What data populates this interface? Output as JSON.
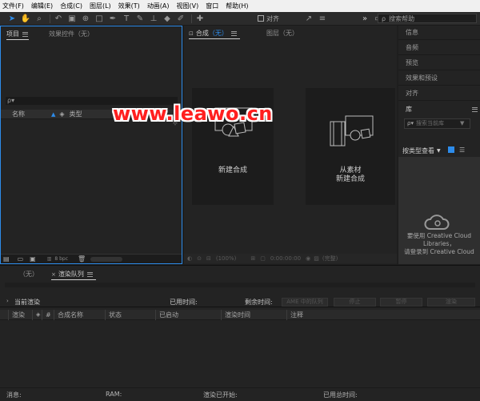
{
  "menu": [
    "文件(F)",
    "编辑(E)",
    "合成(C)",
    "图层(L)",
    "效果(T)",
    "动画(A)",
    "视图(V)",
    "窗口",
    "帮助(H)"
  ],
  "toolbar": {
    "snap_label": "对齐",
    "search_placeholder": "搜索帮助"
  },
  "project": {
    "tab_project": "项目",
    "tab_effects": "效果控件（无）",
    "search_icon_text": "ρ▾",
    "col_name": "名称",
    "col_type": "类型",
    "bpc": "8 bpc"
  },
  "comp": {
    "tab_comp_prefix": "合成",
    "tab_comp_value": "（无）",
    "tab_layer": "图层（无）",
    "new_comp": "新建合成",
    "from_footage_line1": "从素材",
    "from_footage_line2": "新建合成",
    "footer_zoom": "(100%)",
    "footer_time": "0:00:00:00",
    "footer_res": "(完整)"
  },
  "right_panel": {
    "items": [
      "信息",
      "音频",
      "预览",
      "效果和预设",
      "对齐"
    ],
    "library_title": "库",
    "library_search_placeholder": "搜索当前库",
    "view_by_type": "按类型查看",
    "cc_line1": "要使用 Creative Cloud",
    "cc_line2": "Libraries，",
    "cc_line3": "请登录到 Creative Cloud"
  },
  "bottom": {
    "tab_none": "（无）",
    "tab_render": "渲染队列",
    "current_render": "当前渲染",
    "elapsed": "已用时间:",
    "remaining": "剩余时间:",
    "ame_queue": "AME 中的队列",
    "stop": "停止",
    "pause": "暂停",
    "render": "渲染",
    "cols": {
      "render": "渲染",
      "hash": "#",
      "comp_name": "合成名称",
      "status": "状态",
      "started": "已启动",
      "render_time": "渲染时间",
      "comment": "注释"
    }
  },
  "status": {
    "message": "消息:",
    "ram": "RAM:",
    "render_started": "渲染已开始:",
    "total_time": "已用总时间:"
  },
  "watermark": "www.leawo.cn"
}
